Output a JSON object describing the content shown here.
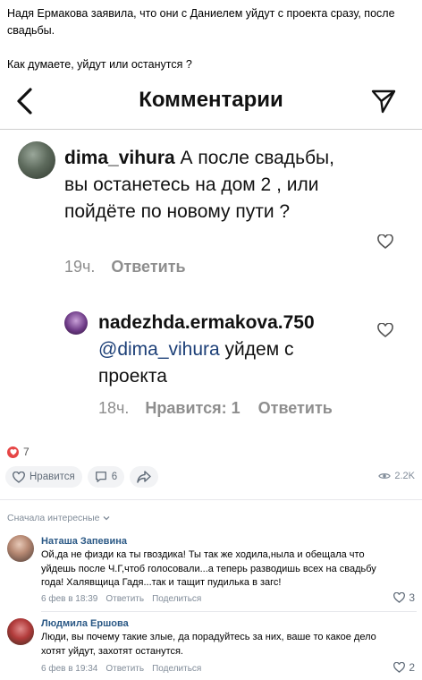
{
  "post": {
    "line1": "Надя Ермакова заявила, что они с Даниелем уйдут с проекта сразу, после свадьбы.",
    "line2": "Как думаете, уйдут или останутся ?"
  },
  "screenshot": {
    "title": "Комментарии",
    "comment1": {
      "username": "dima_vihura",
      "text": " А после свадьбы, вы останетесь на дом 2 , или пойдёте по новому пути ?",
      "time": "19ч.",
      "reply": "Ответить"
    },
    "comment2": {
      "username": "nadezhda.ermakova.750",
      "mention": "@dima_vihura",
      "text": " уйдем с проекта",
      "time": "18ч.",
      "likes": "Нравится: 1",
      "reply": "Ответить"
    }
  },
  "reactions": {
    "count": "7",
    "like_label": "Нравится",
    "comments_count": "6",
    "views": "2.2K"
  },
  "comments_section": {
    "sort_label": "Сначала интересные",
    "items": [
      {
        "author": "Наташа Запевина",
        "text": "Ой,да не физди ка ты гвоздика! Ты так же ходила,ныла и обещала что уйдешь после Ч.Г,чтоб голосовали...а теперь разводишь всех на свадьбу года! Халявщица Гадя...так и тащит пудилька в загс!",
        "date": "6 фев в 18:39",
        "reply": "Ответить",
        "share": "Поделиться",
        "likes": "3"
      },
      {
        "author": "Людмила Ершова",
        "text": "Люди, вы почему такие злые, да порадуйтесь за них, ваше то какое дело хотят уйдут, захотят останутся.",
        "date": "6 фев в 19:34",
        "reply": "Ответить",
        "share": "Поделиться",
        "likes": "2"
      }
    ]
  },
  "colors": {
    "link": "#2a5885",
    "muted": "#818c99",
    "heart": "#e64646",
    "pill_bg": "#f2f3f5",
    "mention": "#1c3f77"
  },
  "icons": [
    "back-arrow-icon",
    "send-icon",
    "heart-outline-icon",
    "comment-icon",
    "share-icon",
    "eye-icon",
    "chevron-down-icon"
  ]
}
